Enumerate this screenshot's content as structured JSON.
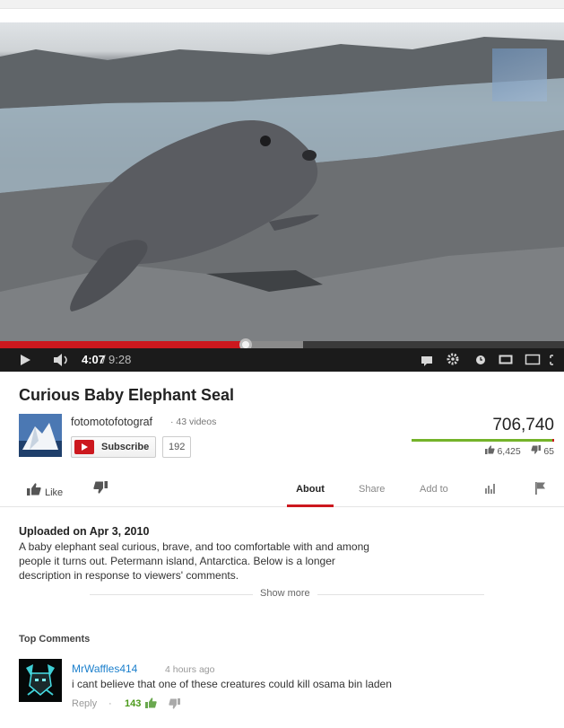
{
  "player": {
    "current_time": "4:07",
    "separator": "/",
    "duration": "9:28",
    "progress_fraction": 0.435
  },
  "video": {
    "title": "Curious Baby Elephant Seal",
    "views": "706,740",
    "likes": "6,425",
    "dislikes": "65",
    "like_ratio": 0.99
  },
  "channel": {
    "name": "fotomotofotograf",
    "videos": "· 43 videos",
    "subscribe_label": "Subscribe",
    "subscriber_count": "192"
  },
  "actions": {
    "like_label": "Like",
    "tabs": [
      "About",
      "Share",
      "Add to"
    ],
    "active_tab": "About"
  },
  "description": {
    "uploaded": "Uploaded on Apr 3, 2010",
    "text": "A baby elephant seal curious, brave, and too comfortable with and among people it turns out. Petermann island, Antarctica. Below is a longer description in response to viewers' comments.",
    "show_more": "Show more"
  },
  "comments": {
    "heading": "Top Comments",
    "items": [
      {
        "author": "MrWaffles414",
        "time": "4 hours ago",
        "text": "i cant believe that one of these creatures could kill osama bin laden",
        "reply_label": "Reply",
        "likes": "143"
      }
    ]
  },
  "colors": {
    "accent_red": "#cc181e",
    "like_green": "#74b32a",
    "link_blue": "#1b7fcc"
  }
}
